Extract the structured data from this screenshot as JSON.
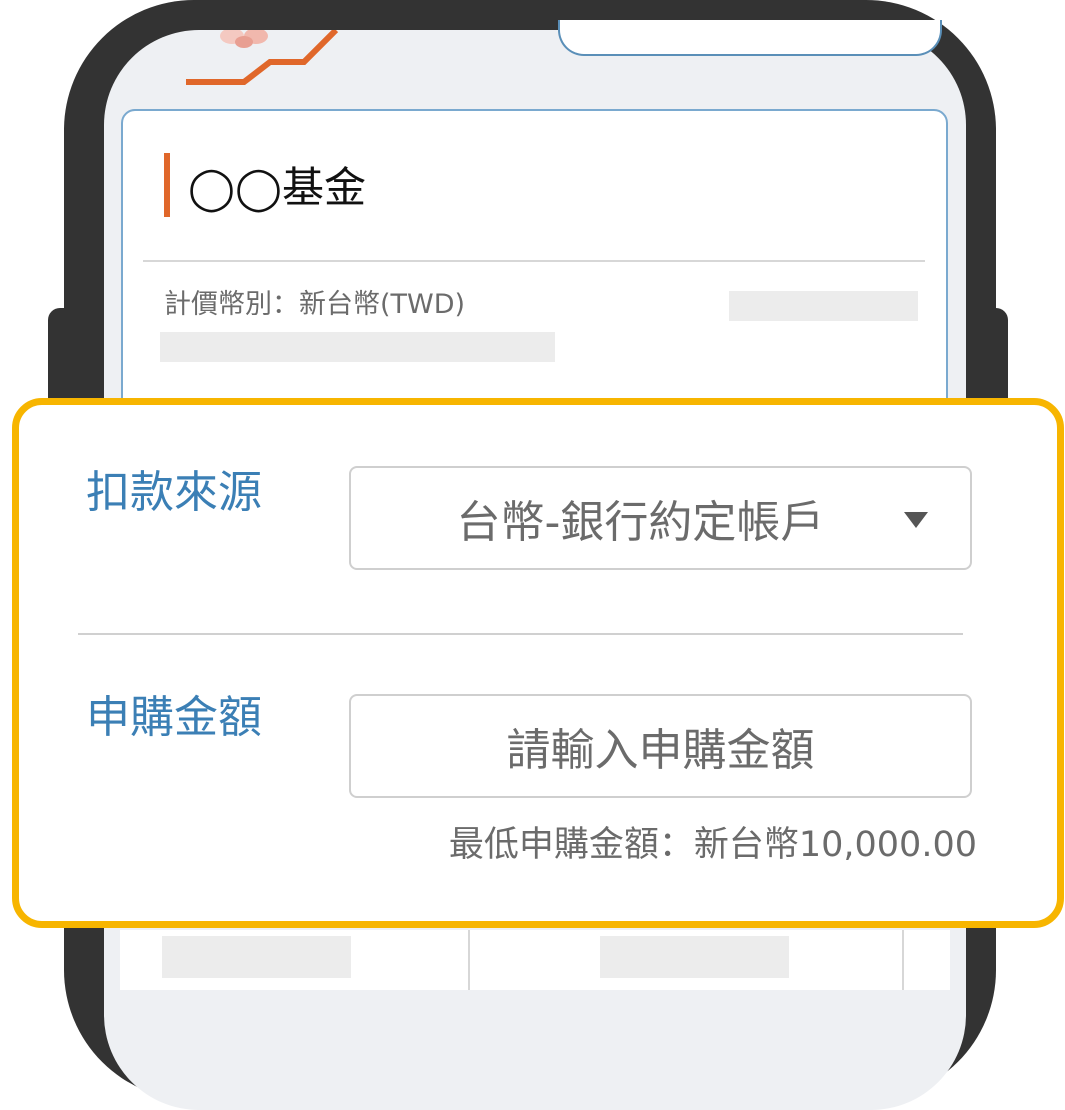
{
  "fund": {
    "title": "◯◯基金",
    "currency_label": "計價幣別：新台幣(TWD)"
  },
  "form": {
    "source_label": "扣款來源",
    "source_value": "台幣-銀行約定帳戶",
    "amount_label": "申購金額",
    "amount_placeholder": "請輸入申購金額",
    "min_note": "最低申購金額：新台幣10,000.00"
  },
  "colors": {
    "accent_orange": "#e0672a",
    "label_blue": "#3b7fb5",
    "highlight_yellow": "#f7b500",
    "phone_frame": "#333333"
  },
  "icons": {
    "dropdown": "caret-down-icon"
  }
}
